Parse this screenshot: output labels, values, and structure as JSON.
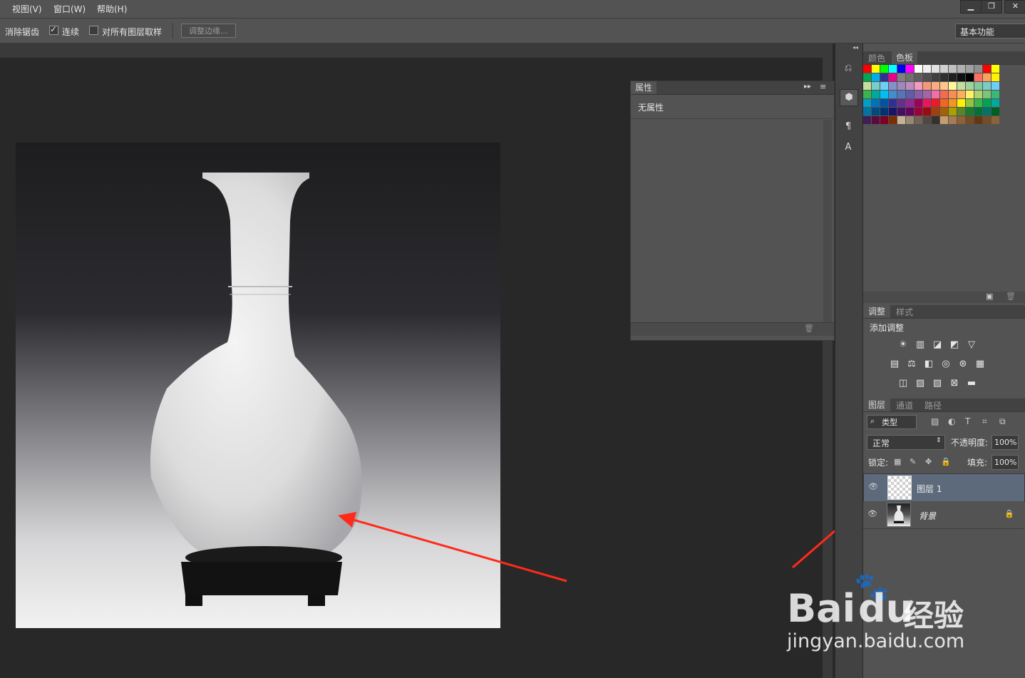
{
  "menu": {
    "items": [
      "视图(V)",
      "窗口(W)",
      "帮助(H)"
    ],
    "window_controls": [
      "▁",
      "❐",
      "✕"
    ]
  },
  "options": {
    "antialias_label": "消除锯齿",
    "contiguous_label": "连续",
    "contiguous_checked": true,
    "sample_all_label": "对所有图层取样",
    "sample_all_checked": false,
    "refine_edge_label": "调整边缘...",
    "workspace_value": "基本功能"
  },
  "properties": {
    "title": "属性",
    "empty_text": "无属性"
  },
  "color_panel": {
    "tabs": [
      "颜色",
      "色板"
    ],
    "active_tab": "色板",
    "swatch_rows": [
      [
        "#ff0000",
        "#ffff00",
        "#00ff00",
        "#00ffff",
        "#0000ff",
        "#ff00ff",
        "#ffffff",
        "#f0f0f0",
        "#e0e0e0",
        "#d0d0d0",
        "#c0c0c0",
        "#b0b0b0",
        "#a0a0a0",
        "#909090",
        "#ff0000",
        "#ffff00"
      ],
      [
        "#00a651",
        "#00aeef",
        "#2e3192",
        "#ec008c",
        "#808080",
        "#707070",
        "#606060",
        "#505050",
        "#404040",
        "#303030",
        "#202020",
        "#101010",
        "#000000",
        "#ff6f61",
        "#f7a35c",
        "#fff200"
      ],
      [
        "#c4df9b",
        "#7accc8",
        "#6dcff6",
        "#8393ca",
        "#a187be",
        "#bd8cbf",
        "#f49ac1",
        "#f7977a",
        "#f9ad81",
        "#fdc68a",
        "#fff79a",
        "#c4df9b",
        "#a3d39c",
        "#82ca9d",
        "#7accc8",
        "#6ecff6"
      ],
      [
        "#39b54a",
        "#00a99d",
        "#00bff3",
        "#448ccb",
        "#5674b9",
        "#605ca8",
        "#855fa8",
        "#a864a8",
        "#f06eaa",
        "#f26c4f",
        "#f68e55",
        "#fbaf5c",
        "#fff467",
        "#acd372",
        "#7cc576",
        "#3bb878"
      ],
      [
        "#00a0c6",
        "#0072bc",
        "#0054a6",
        "#2e3192",
        "#662d91",
        "#92278f",
        "#9e005d",
        "#ed145b",
        "#ed1c24",
        "#f26522",
        "#f7941d",
        "#fff200",
        "#8dc63f",
        "#39b54a",
        "#00a651",
        "#00a99d"
      ],
      [
        "#0076a3",
        "#004a80",
        "#003471",
        "#1b1464",
        "#440e62",
        "#630460",
        "#9e0039",
        "#9d0a0e",
        "#a0410d",
        "#a36209",
        "#aba000",
        "#598527",
        "#197b30",
        "#007236",
        "#00746b",
        "#005e20"
      ],
      [
        "#3f1f55",
        "#5b0a3e",
        "#7a0026",
        "#7b2e00",
        "#c7b299",
        "#998675",
        "#736357",
        "#534741",
        "#37302d",
        "#c69c6d",
        "#a67c52",
        "#8c6239",
        "#754c24",
        "#603913",
        "#754c24",
        "#8c6239"
      ]
    ]
  },
  "adjustments": {
    "tabs": [
      "调整",
      "样式"
    ],
    "active_tab": "调整",
    "title": "添加调整",
    "icon_rows": [
      [
        "brightness-icon",
        "levels-icon",
        "curves-icon",
        "exposure-icon",
        "vibrance-icon"
      ],
      [
        "hue-saturation-icon",
        "color-balance-icon",
        "black-white-icon",
        "photo-filter-icon",
        "channel-mixer-icon",
        "color-lookup-icon"
      ],
      [
        "invert-icon",
        "posterize-icon",
        "threshold-icon",
        "selective-color-icon",
        "gradient-map-icon"
      ]
    ],
    "icon_glyphs": [
      [
        "☀",
        "▥",
        "◪",
        "◩",
        "▽"
      ],
      [
        "▤",
        "⚖",
        "◧",
        "◎",
        "⊛",
        "▦"
      ],
      [
        "◫",
        "▨",
        "▧",
        "⊠",
        "▬"
      ]
    ]
  },
  "layers": {
    "tabs": [
      "图层",
      "通道",
      "路径"
    ],
    "active_tab": "图层",
    "filter_kind": "类型",
    "blend_mode": "正常",
    "opacity_label": "不透明度:",
    "opacity_value": "100%",
    "lock_label": "锁定:",
    "fill_label": "填充:",
    "fill_value": "100%",
    "items": [
      {
        "name": "图层 1",
        "selected": true
      },
      {
        "name": "背景",
        "selected": false
      }
    ]
  },
  "watermark": {
    "brand": "Bai",
    "brand2": "du",
    "cn": "经验",
    "url": "jingyan.baidu.com"
  }
}
